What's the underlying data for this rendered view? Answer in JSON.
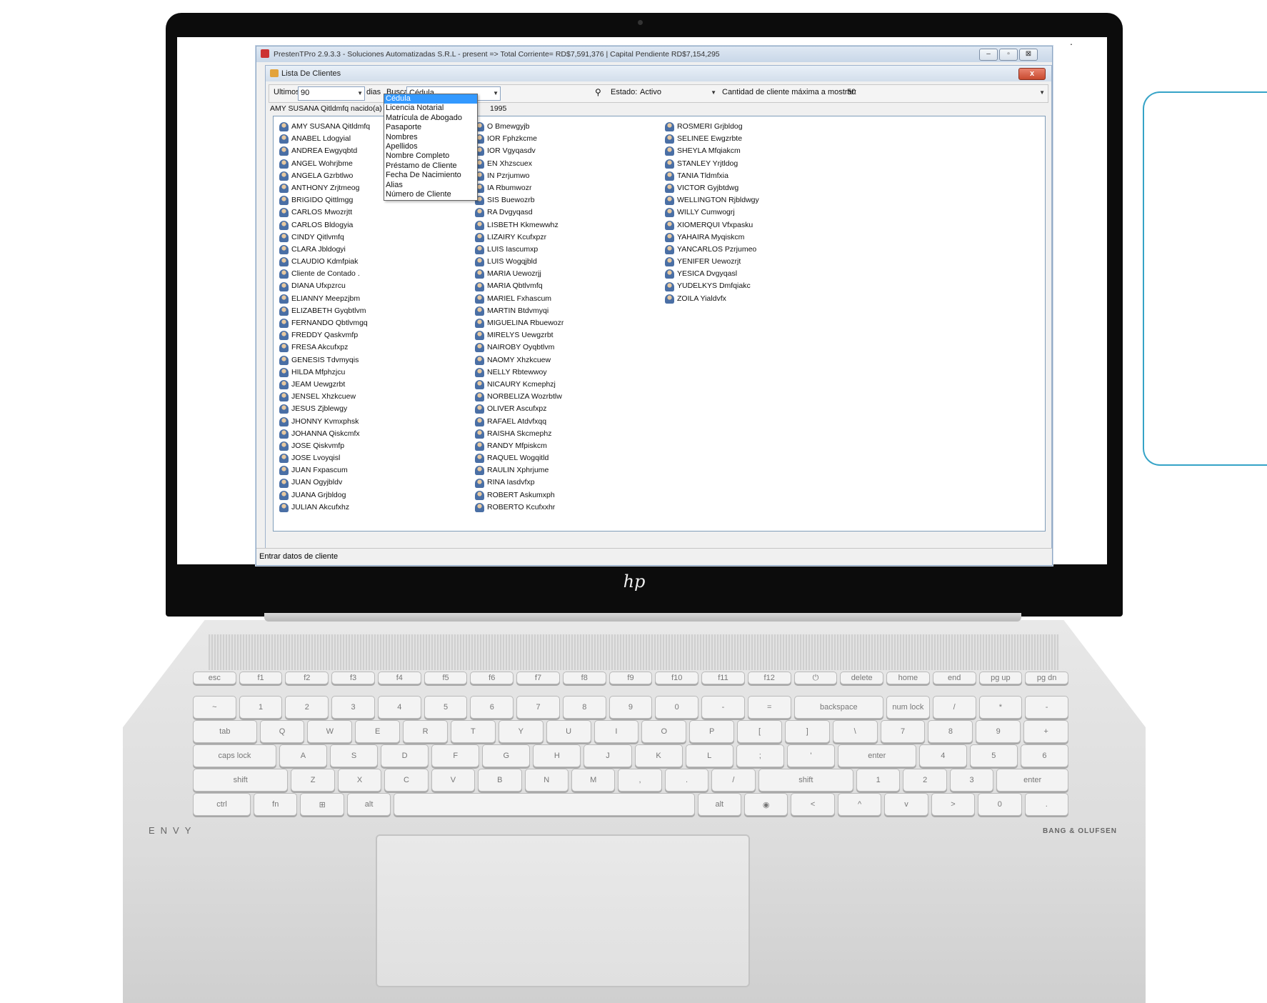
{
  "window": {
    "title": "PrestenTPro 2.9.3.3 - Soluciones Automatizadas S.R.L - present => Total Corriente= RD$7,591,376 | Capital Pendiente RD$7,154,295",
    "min": "–",
    "max": "▫",
    "close": "⊠"
  },
  "dialog": {
    "title": "Lista De Clientes",
    "close": "x"
  },
  "toolbar": {
    "ultimos_label": "Ultimos",
    "ultimos_value": "90",
    "dias_label": "dias",
    "buscar_label": "Buscar:",
    "buscar_value": "Cédula",
    "estado_label": "Estado:",
    "estado_value": "Activo",
    "cantidad_label": "Cantidad de cliente máxima a mostrar:",
    "cantidad_value": "50"
  },
  "info": {
    "left": "AMY SUSANA Qitldmfq nacido(a) en Santo",
    "right": "1995"
  },
  "dropdown_options": [
    "Cédula",
    "Licencia Notarial",
    "Matrícula de Abogado",
    "Pasaporte",
    "Nombres",
    "Apellidos",
    "Nombre Completo",
    "Préstamo de Cliente",
    "Fecha De Nacimiento",
    "Alias",
    "Número de Cliente"
  ],
  "clients": {
    "col1": [
      "AMY SUSANA Qitldmfq",
      "ANABEL Ldogyial",
      "ANDREA Ewgyqbtd",
      "ANGEL Wohrjbme",
      "ANGELA Gzrbtlwo",
      "ANTHONY Zrjtmeog",
      "BRIGIDO Qittlmgg",
      "CARLOS Mwozrjtt",
      "CARLOS Bldogyia",
      "CINDY Qitlvmfq",
      "CLARA Jbldogyi",
      "CLAUDIO Kdmfpiak",
      "Cliente de Contado .",
      "DIANA Ufxpzrcu",
      "ELIANNY Meepzjbm",
      "ELIZABETH Gyqbtlvm",
      "FERNANDO Qbtlvmgq",
      "FREDDY Qaskvmfp",
      "FRESA Akcufxpz",
      "GENESIS Tdvmyqis",
      "HILDA Mfphzjcu",
      "JEAM Uewgzrbt",
      "JENSEL Xhzkcuew",
      "JESUS Zjblewgy",
      "JHONNY Kvmxphsk",
      "JOHANNA Qiskcmfx",
      "JOSE Qiskvmfp",
      "JOSE Lvoyqisl",
      "JUAN Fxpascum",
      "JUAN Ogyjbldv",
      "JUANA Grjbldog",
      "JULIAN Akcufxhz"
    ],
    "col2": [
      "O Bmewgyjb",
      "IOR Fphzkcme",
      "IOR Vgyqasdv",
      "EN Xhzscuex",
      "IN Pzrjumwo",
      "IA Rbumwozr",
      "SIS Buewozrb",
      "RA Dvgyqasd",
      "LISBETH Kkmewwhz",
      "LIZAIRY Kcufxpzr",
      "LUIS Iascumxp",
      "LUIS Wogqjbld",
      "MARIA Uewozrjj",
      "MARIA Qbtlvmfq",
      "MARIEL Fxhascum",
      "MARTIN Btdvmyqi",
      "MIGUELINA Rbuewozr",
      "MIRELYS Uewgzrbt",
      "NAIROBY Oyqbtlvm",
      "NAOMY Xhzkcuew",
      "NELLY Rbtewwoy",
      "NICAURY Kcmephzj",
      "NORBELIZA Wozrbtlw",
      "OLIVER Ascufxpz",
      "RAFAEL Atdvfxqq",
      "RAISHA Skcmephz",
      "RANDY Mfpiskcm",
      "RAQUEL Wogqitld",
      "RAULIN Xphrjume",
      "RINA Iasdvfxp",
      "ROBERT Askumxph",
      "ROBERTO Kcufxxhr"
    ],
    "col3": [
      "ROSMERI Grjbldog",
      "SELINEE Ewgzrbte",
      "SHEYLA Mfqiakcm",
      "STANLEY Yrjtldog",
      "TANIA Tldmfxia",
      "VICTOR Gyjbtdwg",
      "WELLINGTON Rjbldwgy",
      "WILLY Cumwogrj",
      "XIOMERQUI Vfxpasku",
      "YAHAIRA Myqiskcm",
      "YANCARLOS Pzrjumeo",
      "YENIFER Uewozrjt",
      "YESICA Dvgyqasl",
      "YUDELKYS Dmfqiakc",
      "ZOILA Yialdvfx"
    ]
  },
  "status": "Entrar datos de cliente",
  "laptop": {
    "brand": "ENVY",
    "audio": "BANG & OLUFSEN",
    "logo": "hp"
  },
  "keyboard": {
    "row0": [
      "esc",
      "f1",
      "f2",
      "f3",
      "f4",
      "f5",
      "f6",
      "f7",
      "f8",
      "f9",
      "f10",
      "f11",
      "f12",
      "⏻",
      "delete",
      "home",
      "end",
      "pg up",
      "pg dn"
    ],
    "row1": [
      "~",
      "1",
      "2",
      "3",
      "4",
      "5",
      "6",
      "7",
      "8",
      "9",
      "0",
      "-",
      "=",
      "backspace",
      "num lock",
      "/",
      "*",
      "-"
    ],
    "row2": [
      "tab",
      "Q",
      "W",
      "E",
      "R",
      "T",
      "Y",
      "U",
      "I",
      "O",
      "P",
      "[",
      "]",
      "\\",
      "7",
      "8",
      "9",
      "+"
    ],
    "row3": [
      "caps lock",
      "A",
      "S",
      "D",
      "F",
      "G",
      "H",
      "J",
      "K",
      "L",
      ";",
      "'",
      "enter",
      "4",
      "5",
      "6"
    ],
    "row4": [
      "shift",
      "Z",
      "X",
      "C",
      "V",
      "B",
      "N",
      "M",
      ",",
      ".",
      "/",
      "shift",
      "1",
      "2",
      "3",
      "enter"
    ],
    "row5": [
      "ctrl",
      "fn",
      "⊞",
      "alt",
      "",
      "alt",
      "◉",
      "<",
      "^",
      "v",
      ">",
      "0",
      "."
    ]
  }
}
